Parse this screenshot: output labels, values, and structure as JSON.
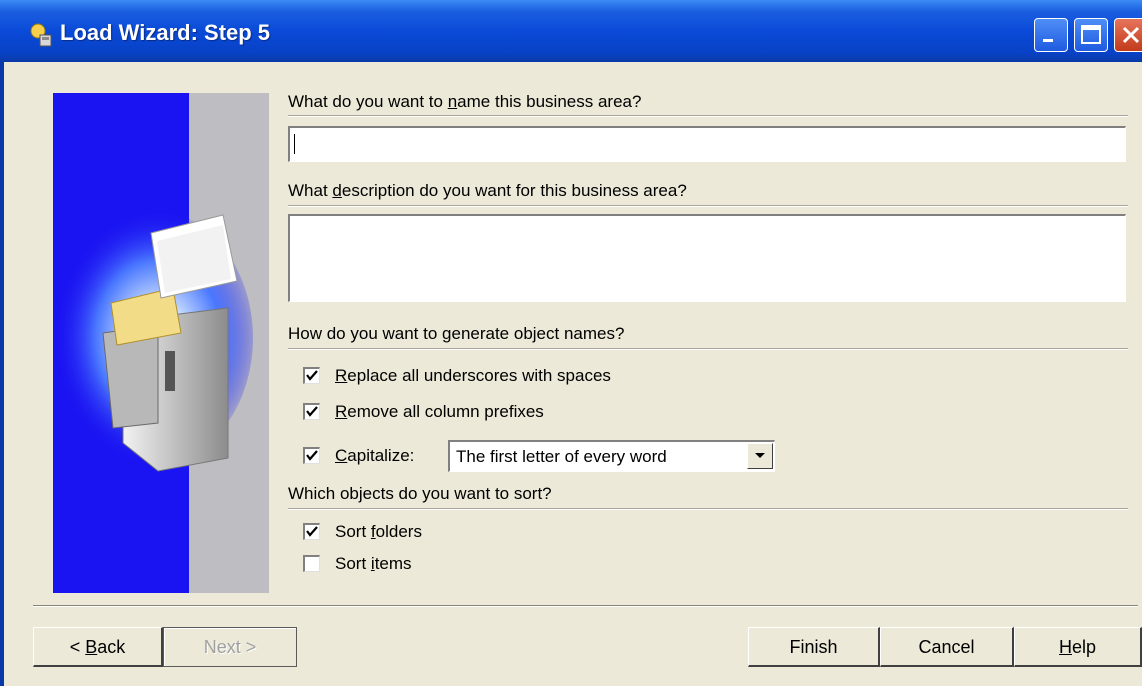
{
  "window": {
    "title": "Load Wizard: Step 5"
  },
  "name_section": {
    "label_pre": "What do you want to ",
    "label_key": "n",
    "label_post": "ame this business area?",
    "value": ""
  },
  "description_section": {
    "label_pre": "What ",
    "label_key": "d",
    "label_post": "escription do you want for this business area?",
    "value": ""
  },
  "naming_section": {
    "label": "How do you want to generate object names?",
    "options": [
      {
        "key": "R",
        "rest": "eplace all underscores with spaces",
        "checked": true
      },
      {
        "key": "R",
        "rest": "emove all column prefixes",
        "checked": true
      },
      {
        "key": "C",
        "rest": "apitalize:",
        "checked": true
      }
    ],
    "capitalize_selected": "The first letter of every word"
  },
  "sort_section": {
    "label": "Which objects do you want to sort?",
    "options": [
      {
        "pre": "Sort ",
        "key": "f",
        "rest": "olders",
        "checked": true
      },
      {
        "pre": "Sort ",
        "key": "i",
        "rest": "tems",
        "checked": false
      }
    ]
  },
  "buttons": {
    "back_pre": "< ",
    "back_key": "B",
    "back_rest": "ack",
    "next": "Next >",
    "finish": "Finish",
    "cancel": "Cancel",
    "help_key": "H",
    "help_rest": "elp"
  },
  "icons": [
    "wizard-app-icon",
    "minimize-icon",
    "maximize-icon",
    "close-icon",
    "filing-cabinet-illustration",
    "checkmark-icon",
    "dropdown-arrow-icon"
  ]
}
